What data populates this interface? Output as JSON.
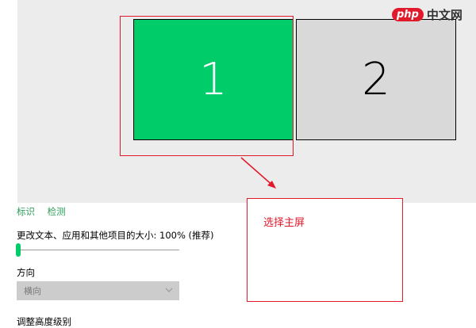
{
  "watermark": {
    "php": "php",
    "site": "中文网"
  },
  "monitors": [
    {
      "number": "1",
      "selected": true
    },
    {
      "number": "2",
      "selected": false
    }
  ],
  "annotation": {
    "text": "选择主屏"
  },
  "links": {
    "identify": "标识",
    "detect": "检测"
  },
  "scale": {
    "label": "更改文本、应用和其他项目的大小: 100% (推荐)",
    "value_percent": 100
  },
  "orientation": {
    "label": "方向",
    "selected": "横向"
  },
  "resolution": {
    "label": "调整高度级别"
  },
  "colors": {
    "selected_monitor": "#00cc6a",
    "other_monitor": "#d9d9d9",
    "annotation": "#e0192b",
    "link": "#2e9e5a"
  }
}
